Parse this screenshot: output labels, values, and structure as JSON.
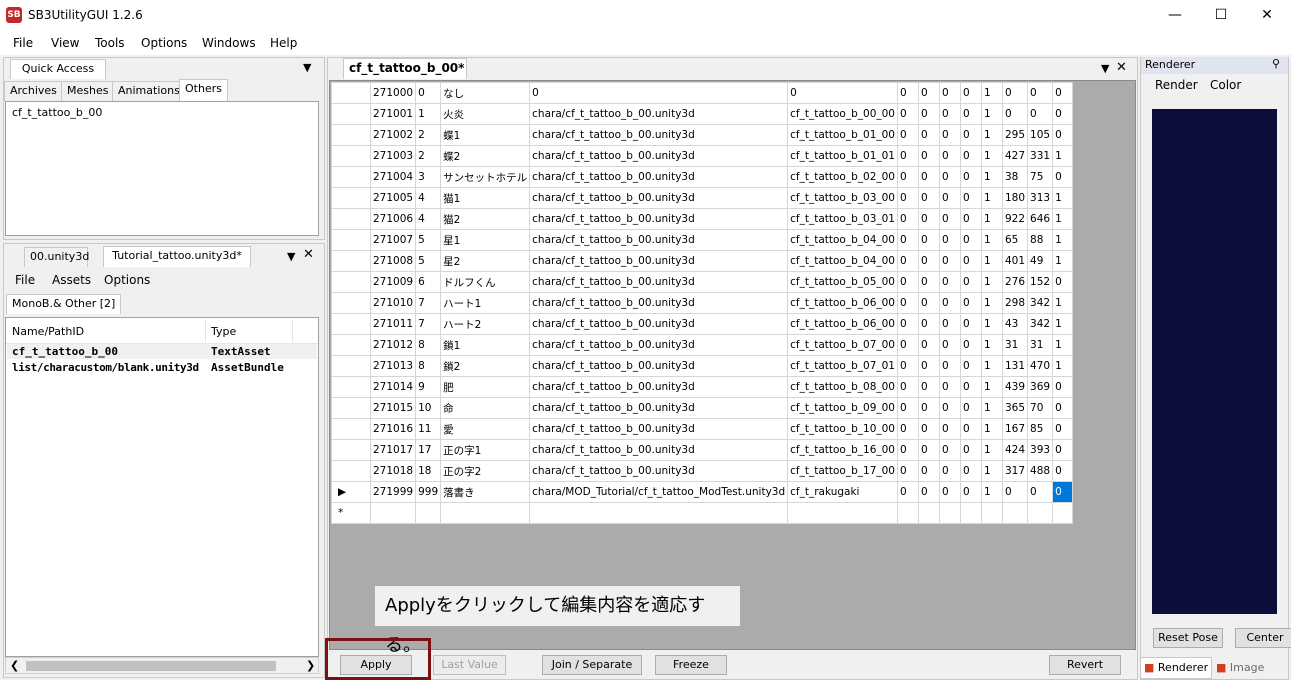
{
  "window": {
    "title": "SB3UtilityGUI 1.2.6",
    "icon": "app-logo-icon"
  },
  "menu": [
    "File",
    "View",
    "Tools",
    "Options",
    "Windows",
    "Help"
  ],
  "left_top": {
    "dock_tab": "Quick Access",
    "tabs": [
      "Archives",
      "Meshes",
      "Animations",
      "Others"
    ],
    "active_tab": "Others",
    "items": [
      "cf_t_tattoo_b_00"
    ]
  },
  "left_bottom": {
    "doc_tabs": [
      "00.unity3d",
      "Tutorial_tattoo.unity3d*"
    ],
    "menu": [
      "File",
      "Assets",
      "Options"
    ],
    "subtab": "MonoB.& Other [2]",
    "columns": [
      "Name/PathID",
      "Type"
    ],
    "rows": [
      {
        "name": "cf_t_tattoo_b_00",
        "type": "TextAsset"
      },
      {
        "name": "list/characustom/blank.unity3d",
        "type": "AssetBundle"
      }
    ]
  },
  "editor": {
    "tab": "cf_t_tattoo_b_00*",
    "rows": [
      [
        "271000",
        "0",
        "なし",
        "0",
        "0",
        "0",
        "0",
        "0",
        "0",
        "1",
        "0",
        "0",
        "0"
      ],
      [
        "271001",
        "1",
        "火炎",
        "chara/cf_t_tattoo_b_00.unity3d",
        "cf_t_tattoo_b_00_00",
        "0",
        "0",
        "0",
        "0",
        "1",
        "0",
        "0",
        "0"
      ],
      [
        "271002",
        "2",
        "蝶1",
        "chara/cf_t_tattoo_b_00.unity3d",
        "cf_t_tattoo_b_01_00",
        "0",
        "0",
        "0",
        "0",
        "1",
        "295",
        "105",
        "0"
      ],
      [
        "271003",
        "2",
        "蝶2",
        "chara/cf_t_tattoo_b_00.unity3d",
        "cf_t_tattoo_b_01_01",
        "0",
        "0",
        "0",
        "0",
        "1",
        "427",
        "331",
        "1"
      ],
      [
        "271004",
        "3",
        "サンセットホテル",
        "chara/cf_t_tattoo_b_00.unity3d",
        "cf_t_tattoo_b_02_00",
        "0",
        "0",
        "0",
        "0",
        "1",
        "38",
        "75",
        "0"
      ],
      [
        "271005",
        "4",
        "猫1",
        "chara/cf_t_tattoo_b_00.unity3d",
        "cf_t_tattoo_b_03_00",
        "0",
        "0",
        "0",
        "0",
        "1",
        "180",
        "313",
        "1"
      ],
      [
        "271006",
        "4",
        "猫2",
        "chara/cf_t_tattoo_b_00.unity3d",
        "cf_t_tattoo_b_03_01",
        "0",
        "0",
        "0",
        "0",
        "1",
        "922",
        "646",
        "1"
      ],
      [
        "271007",
        "5",
        "星1",
        "chara/cf_t_tattoo_b_00.unity3d",
        "cf_t_tattoo_b_04_00",
        "0",
        "0",
        "0",
        "0",
        "1",
        "65",
        "88",
        "1"
      ],
      [
        "271008",
        "5",
        "星2",
        "chara/cf_t_tattoo_b_00.unity3d",
        "cf_t_tattoo_b_04_00",
        "0",
        "0",
        "0",
        "0",
        "1",
        "401",
        "49",
        "1"
      ],
      [
        "271009",
        "6",
        "ドルフくん",
        "chara/cf_t_tattoo_b_00.unity3d",
        "cf_t_tattoo_b_05_00",
        "0",
        "0",
        "0",
        "0",
        "1",
        "276",
        "152",
        "0"
      ],
      [
        "271010",
        "7",
        "ハート1",
        "chara/cf_t_tattoo_b_00.unity3d",
        "cf_t_tattoo_b_06_00",
        "0",
        "0",
        "0",
        "0",
        "1",
        "298",
        "342",
        "1"
      ],
      [
        "271011",
        "7",
        "ハート2",
        "chara/cf_t_tattoo_b_00.unity3d",
        "cf_t_tattoo_b_06_00",
        "0",
        "0",
        "0",
        "0",
        "1",
        "43",
        "342",
        "1"
      ],
      [
        "271012",
        "8",
        "鎖1",
        "chara/cf_t_tattoo_b_00.unity3d",
        "cf_t_tattoo_b_07_00",
        "0",
        "0",
        "0",
        "0",
        "1",
        "31",
        "31",
        "1"
      ],
      [
        "271013",
        "8",
        "鎖2",
        "chara/cf_t_tattoo_b_00.unity3d",
        "cf_t_tattoo_b_07_01",
        "0",
        "0",
        "0",
        "0",
        "1",
        "131",
        "470",
        "1"
      ],
      [
        "271014",
        "9",
        "肥",
        "chara/cf_t_tattoo_b_00.unity3d",
        "cf_t_tattoo_b_08_00",
        "0",
        "0",
        "0",
        "0",
        "1",
        "439",
        "369",
        "0"
      ],
      [
        "271015",
        "10",
        "命",
        "chara/cf_t_tattoo_b_00.unity3d",
        "cf_t_tattoo_b_09_00",
        "0",
        "0",
        "0",
        "0",
        "1",
        "365",
        "70",
        "0"
      ],
      [
        "271016",
        "11",
        "愛",
        "chara/cf_t_tattoo_b_00.unity3d",
        "cf_t_tattoo_b_10_00",
        "0",
        "0",
        "0",
        "0",
        "1",
        "167",
        "85",
        "0"
      ],
      [
        "271017",
        "17",
        "正の字1",
        "chara/cf_t_tattoo_b_00.unity3d",
        "cf_t_tattoo_b_16_00",
        "0",
        "0",
        "0",
        "0",
        "1",
        "424",
        "393",
        "0"
      ],
      [
        "271018",
        "18",
        "正の字2",
        "chara/cf_t_tattoo_b_00.unity3d",
        "cf_t_tattoo_b_17_00",
        "0",
        "0",
        "0",
        "0",
        "1",
        "317",
        "488",
        "0"
      ],
      [
        "271999",
        "999",
        "落書き",
        "chara/MOD_Tutorial/cf_t_tattoo_ModTest.unity3d",
        "cf_t_rakugaki",
        "0",
        "0",
        "0",
        "0",
        "1",
        "0",
        "0",
        "0"
      ]
    ],
    "new_row_marker": "*",
    "current_row_marker": "▶",
    "callout": "Applyをクリックして編集内容を適応する。",
    "buttons": {
      "apply": "Apply",
      "last_value": "Last Value",
      "join": "Join / Separate",
      "freeze": "Freeze",
      "revert": "Revert"
    },
    "highlight_color": "#7b1010",
    "selected_cell_color": "#0078d7"
  },
  "renderer": {
    "title": "Renderer",
    "menu": [
      "Render",
      "Color"
    ],
    "viewport_color": "#0b0d3a",
    "buttons": {
      "reset_pose": "Reset Pose",
      "center": "Center"
    },
    "bottom_tabs": [
      "Renderer",
      "Image"
    ]
  }
}
